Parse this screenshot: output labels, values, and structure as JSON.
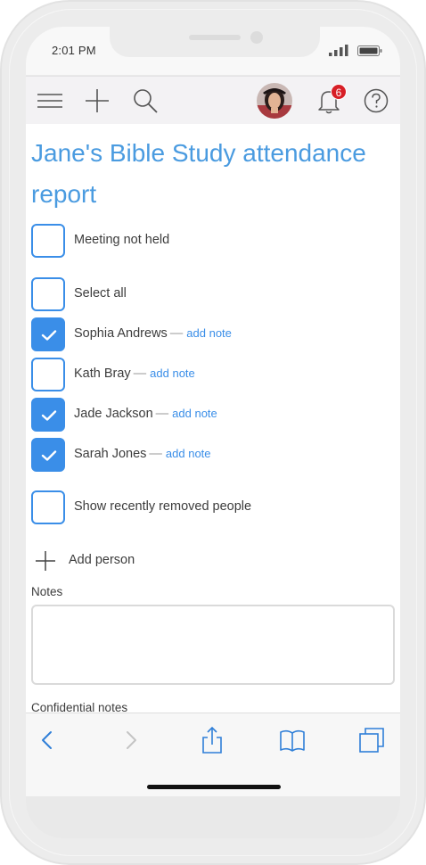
{
  "status_bar": {
    "time": "2:01 PM"
  },
  "header": {
    "menu_icon": "hamburger-menu-icon",
    "add_icon": "plus-icon",
    "search_icon": "search-icon",
    "avatar": "user-avatar",
    "notifications_icon": "bell-icon",
    "notification_count": "6",
    "help_icon": "help-circle-icon"
  },
  "page": {
    "title": "Jane's Bible Study attendance report"
  },
  "options": {
    "meeting_not_held": "Meeting not held",
    "select_all": "Select all",
    "show_removed": "Show recently removed people"
  },
  "people": [
    {
      "name": "Sophia Andrews",
      "checked": true,
      "note_link": "add note"
    },
    {
      "name": "Kath Bray",
      "checked": false,
      "note_link": "add note"
    },
    {
      "name": "Jade Jackson",
      "checked": true,
      "note_link": "add note"
    },
    {
      "name": "Sarah Jones",
      "checked": true,
      "note_link": "add note"
    }
  ],
  "separator": "—",
  "add_person": {
    "label": "Add person"
  },
  "notes": {
    "label": "Notes",
    "value": ""
  },
  "confidential_notes": {
    "label": "Confidential notes"
  },
  "browser_toolbar": {
    "icons": [
      "back-icon",
      "forward-icon",
      "share-icon",
      "bookmarks-icon",
      "tabs-icon"
    ]
  },
  "colors": {
    "accent": "#3a8ee8",
    "title": "#4a9be0",
    "badge": "#d71f26"
  }
}
